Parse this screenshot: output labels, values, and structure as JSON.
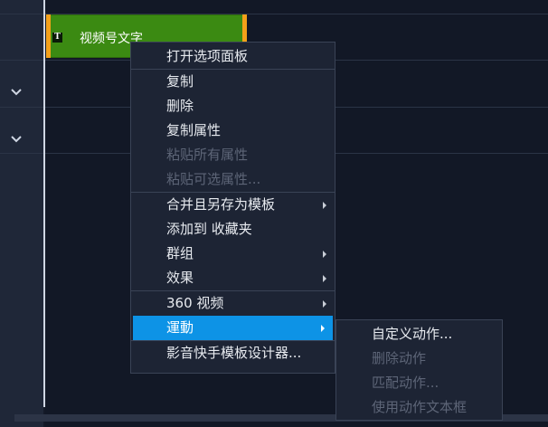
{
  "clip": {
    "title": "视频号文字",
    "type_icon": "T"
  },
  "context_menu": {
    "groups": [
      [
        {
          "label": "打开选项面板",
          "enabled": true,
          "submenu": false
        }
      ],
      [
        {
          "label": "复制",
          "enabled": true,
          "submenu": false
        },
        {
          "label": "删除",
          "enabled": true,
          "submenu": false
        },
        {
          "label": "复制属性",
          "enabled": true,
          "submenu": false
        },
        {
          "label": "粘贴所有属性",
          "enabled": false,
          "submenu": false
        },
        {
          "label": "粘贴可选属性...",
          "enabled": false,
          "submenu": false
        }
      ],
      [
        {
          "label": "合并且另存为模板",
          "enabled": true,
          "submenu": true
        },
        {
          "label": "添加到 收藏夹",
          "enabled": true,
          "submenu": false
        },
        {
          "label": "群组",
          "enabled": true,
          "submenu": true
        },
        {
          "label": "效果",
          "enabled": true,
          "submenu": true
        }
      ],
      [
        {
          "label": "360 视频",
          "enabled": true,
          "submenu": true
        },
        {
          "label": "運動",
          "enabled": true,
          "submenu": true,
          "highlighted": true
        }
      ],
      [
        {
          "label": "影音快手模板设计器...",
          "enabled": true,
          "submenu": false
        }
      ]
    ]
  },
  "submenu": {
    "items": [
      {
        "label": "自定义动作...",
        "enabled": true
      },
      {
        "label": "删除动作",
        "enabled": false
      },
      {
        "label": "匹配动作...",
        "enabled": false
      },
      {
        "label": "使用动作文本框",
        "enabled": false
      }
    ]
  },
  "colors": {
    "highlight": "#0d93e6",
    "clip_fill": "#3b8a12",
    "clip_handle": "#f4a11a"
  }
}
